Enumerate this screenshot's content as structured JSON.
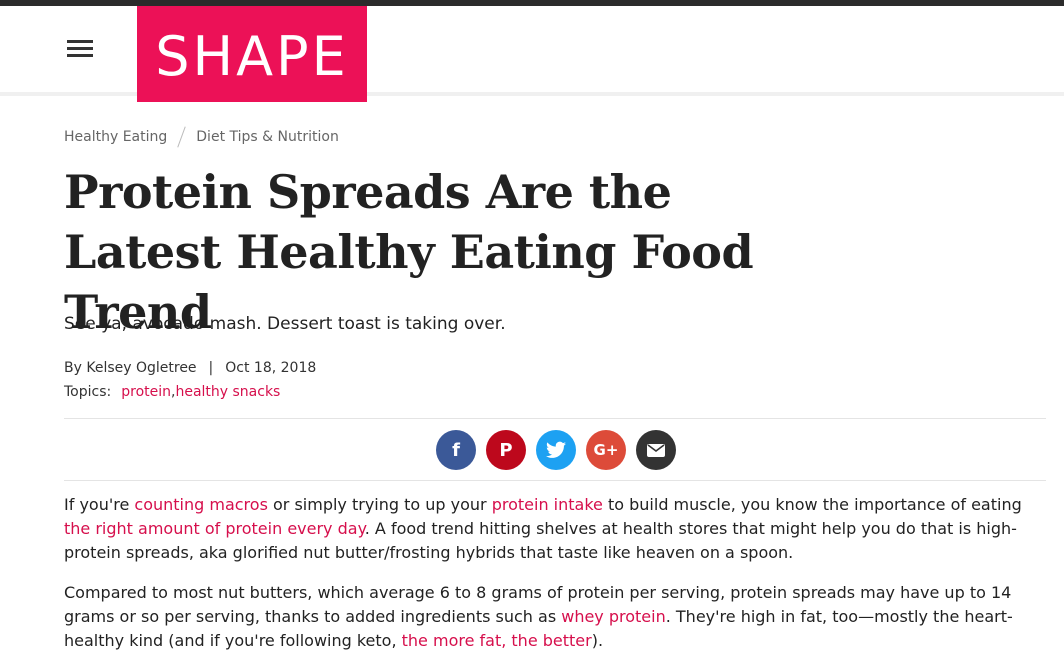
{
  "brand": {
    "logo_text": "SHAPE",
    "accent_color": "#ec1157",
    "link_color": "#d60f4c"
  },
  "header": {
    "menu_icon": "hamburger-menu-icon"
  },
  "breadcrumb": {
    "items": [
      "Healthy Eating",
      "Diet Tips & Nutrition"
    ]
  },
  "article": {
    "title": "Protein Spreads Are the Latest Healthy Eating Food Trend",
    "dek": "See ya, avocado mash. Dessert toast is taking over.",
    "byline_prefix": "By ",
    "author": "Kelsey Ogletree",
    "separator": "|",
    "date": "Oct 18, 2018",
    "topics_label": "Topics:",
    "topics": [
      "protein",
      "healthy snacks"
    ],
    "topic_sep": ","
  },
  "share": {
    "buttons": [
      {
        "name": "facebook",
        "icon": "facebook-icon",
        "glyph": "f",
        "color": "#3b5998"
      },
      {
        "name": "pinterest",
        "icon": "pinterest-icon",
        "glyph": "P",
        "color": "#bd081c"
      },
      {
        "name": "twitter",
        "icon": "twitter-icon",
        "glyph": "t",
        "color": "#1da1f2"
      },
      {
        "name": "google-plus",
        "icon": "google-plus-icon",
        "glyph": "G+",
        "color": "#dd4b39"
      },
      {
        "name": "email",
        "icon": "email-icon",
        "glyph": "✉",
        "color": "#333333"
      }
    ]
  },
  "body": {
    "p1": {
      "t1": "If you're ",
      "l1": "counting macros",
      "t2": " or simply trying to up your ",
      "l2": "protein intake",
      "t3": " to build muscle, you know the importance of eating ",
      "l3": "the right amount of protein every day",
      "t4": ". A food trend hitting shelves at health stores that might help you do that is high-protein spreads, aka glorified nut butter/frosting hybrids that taste like heaven on a spoon."
    },
    "p2": {
      "t1": "Compared to most nut butters, which average 6 to 8 grams of protein per serving, protein spreads may have up to 14 grams or so per serving, thanks to added ingredients such as ",
      "l1": "whey protein",
      "t2": ". They're high in fat, too—mostly the heart-healthy kind (and if you're following keto, ",
      "l2": "the more fat, the better",
      "t3": ")."
    }
  }
}
